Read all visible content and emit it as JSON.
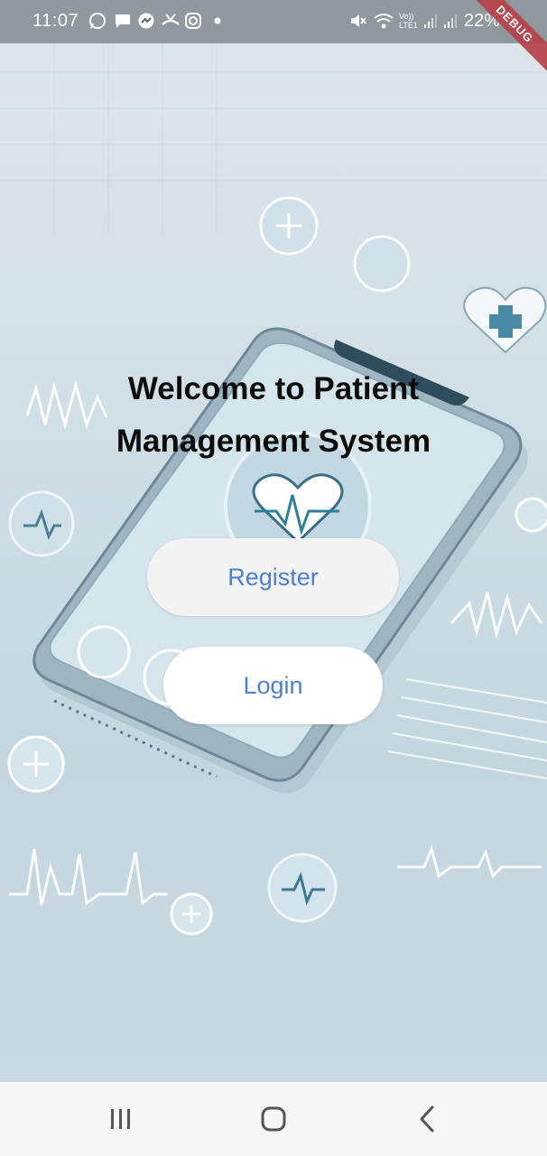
{
  "status_bar": {
    "time": "11:07",
    "battery": "22%",
    "icons": [
      "whatsapp-icon",
      "message-icon",
      "messenger-icon",
      "missed-call-icon",
      "instagram-icon",
      "dot-icon",
      "mute-icon",
      "wifi-icon",
      "volte-icon",
      "signal-icon",
      "signal-icon",
      "battery-icon"
    ],
    "volte_label": "Vo)) LTE1"
  },
  "debug_banner": "DEBUG",
  "main": {
    "title": "Welcome to Patient Management System",
    "register_label": "Register",
    "login_label": "Login"
  },
  "nav_bar": {
    "icons": [
      "recent-apps-icon",
      "home-icon",
      "back-icon"
    ]
  },
  "colors": {
    "button_text": "#4d7fd1",
    "title_text": "#0b0b0b",
    "debug_ribbon": "#b8424a"
  }
}
